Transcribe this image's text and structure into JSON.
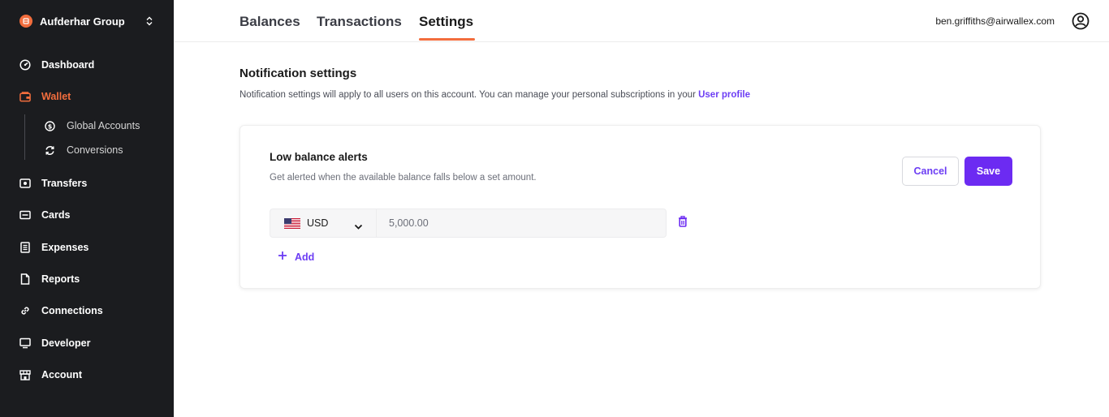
{
  "sidebar": {
    "org_name": "Aufderhar Group",
    "items": [
      {
        "label": "Dashboard",
        "icon": "dashboard-icon"
      },
      {
        "label": "Wallet",
        "icon": "wallet-icon",
        "active": true
      },
      {
        "label": "Transfers",
        "icon": "transfers-icon"
      },
      {
        "label": "Cards",
        "icon": "cards-icon"
      },
      {
        "label": "Expenses",
        "icon": "expenses-icon"
      },
      {
        "label": "Reports",
        "icon": "reports-icon"
      },
      {
        "label": "Connections",
        "icon": "link-icon"
      },
      {
        "label": "Developer",
        "icon": "monitor-icon"
      },
      {
        "label": "Account",
        "icon": "store-icon"
      }
    ],
    "wallet_subitems": [
      {
        "label": "Global Accounts",
        "icon": "dollar-circle-icon"
      },
      {
        "label": "Conversions",
        "icon": "refresh-icon"
      }
    ]
  },
  "header": {
    "tabs": [
      {
        "label": "Balances"
      },
      {
        "label": "Transactions"
      },
      {
        "label": "Settings",
        "active": true
      }
    ],
    "user_email": "ben.griffiths@airwallex.com"
  },
  "main": {
    "title": "Notification settings",
    "description": "Notification settings will apply to all users on this account. You can manage your personal subscriptions in your",
    "link_text": "User profile",
    "card": {
      "title": "Low balance alerts",
      "description": "Get alerted when the available balance falls below a set amount.",
      "cancel_label": "Cancel",
      "save_label": "Save",
      "currency": "USD",
      "amount": "5,000.00",
      "add_label": "Add"
    }
  },
  "colors": {
    "accent": "#f26d3d",
    "primary": "#6c2bf2",
    "sidebar_bg": "#1b1c1f"
  }
}
